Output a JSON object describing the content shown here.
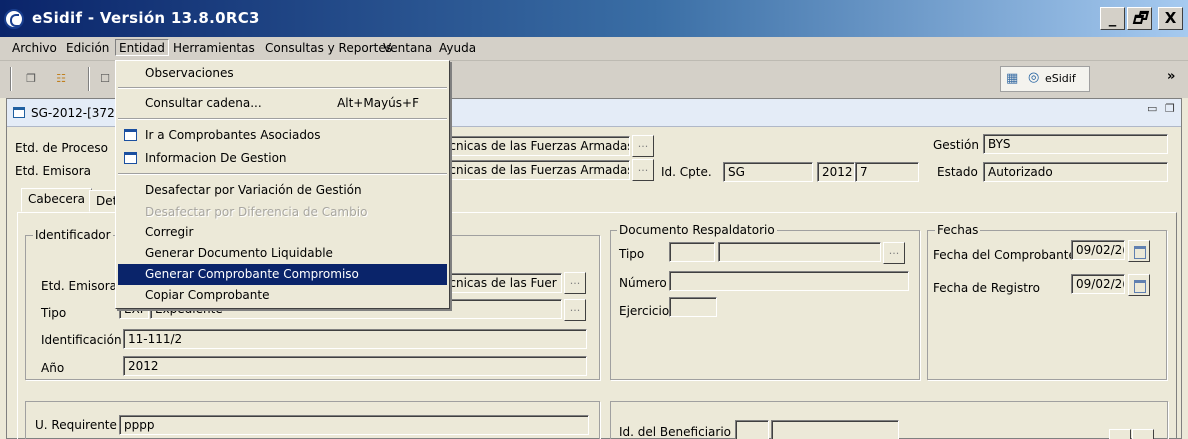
{
  "window": {
    "title": "eSidif - Versión 13.8.0RC3",
    "buttons": [
      "_",
      "▫",
      "X"
    ]
  },
  "menubar": [
    "Archivo",
    "Edición",
    "Entidad",
    "Herramientas",
    "Consultas y Reportes",
    "Ventana",
    "Ayuda"
  ],
  "toolbar": {
    "esidif_label": "eSidif",
    "overflow": "»"
  },
  "document": {
    "title": "SG-2012-[372",
    "etd_proceso_label": "Etd. de Proceso",
    "etd_emisora_label": "Etd. Emisora",
    "etd_proceso_value": "écnicas de las Fuerzas Armadas",
    "etd_emisora_value": "écnicas de las Fuerzas Armadas",
    "ellipsis": "...",
    "id_cpte_label": "Id. Cpte.",
    "id_cpte_tipo": "SG",
    "id_cpte_year": "2012",
    "id_cpte_num": "7",
    "gestion_label": "Gestión",
    "gestion_value": "BYS",
    "estado_label": "Estado",
    "estado_value": "Autorizado"
  },
  "tabs": [
    "Cabecera",
    "Det"
  ],
  "identificador": {
    "title": "Identificador",
    "etd_emisora_label": "Etd. Emisora",
    "etd_emisora_value": "écnicas de las Fuer",
    "tipo_label": "Tipo",
    "tipo_code": "EXP",
    "tipo_value": "Expediente",
    "identificacion_label": "Identificación",
    "identificacion_value": "11-111/2",
    "anio_label": "Año",
    "anio_value": "2012"
  },
  "doc_respaldatorio": {
    "title": "Documento Respaldatorio",
    "tipo_label": "Tipo",
    "numero_label": "Número",
    "ejercicio_label": "Ejercicio"
  },
  "fechas": {
    "title": "Fechas",
    "comprobante_label": "Fecha del Comprobante",
    "comprobante_value": "09/02/2(",
    "registro_label": "Fecha de Registro",
    "registro_value": "09/02/2("
  },
  "bottom": {
    "requirente_label": "U. Requirente",
    "requirente_value": "pppp",
    "beneficiario_label": "Id. del Beneficiario"
  },
  "dropdown": {
    "items": [
      {
        "label": "Observaciones"
      },
      {
        "label": "Consultar cadena...",
        "accel": "Alt+Mayús+F"
      },
      {
        "label": "Ir a Comprobantes Asociados",
        "icon": "window-icon"
      },
      {
        "label": "Informacion De Gestion",
        "icon": "window-icon"
      },
      {
        "label": "Desafectar por Variación de Gestión"
      },
      {
        "label": "Desafectar por Diferencia de Cambio",
        "disabled": true
      },
      {
        "label": "Corregir"
      },
      {
        "label": "Generar Documento Liquidable"
      },
      {
        "label": "Generar Comprobante Compromiso",
        "selected": true
      },
      {
        "label": "Copiar Comprobante"
      }
    ]
  }
}
